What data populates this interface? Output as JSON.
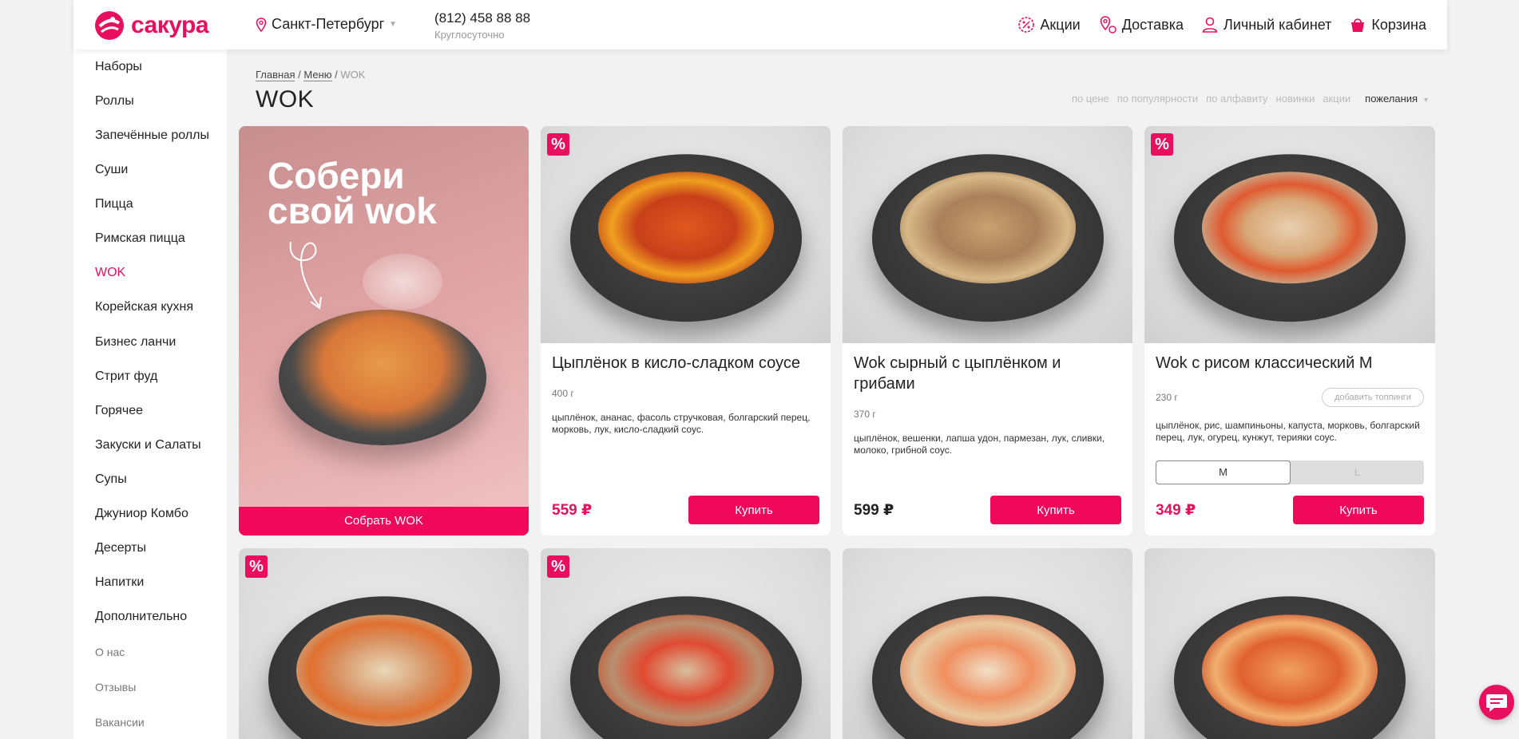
{
  "header": {
    "logo_text": "сакура",
    "city": "Санкт-Петербург",
    "phone": "(812) 458 88 88",
    "phone_note": "Круглосуточно",
    "nav": [
      {
        "label": "Акции",
        "icon": "percent-badge-icon"
      },
      {
        "label": "Доставка",
        "icon": "map-pin-icon"
      },
      {
        "label": "Личный кабинет",
        "icon": "user-icon"
      },
      {
        "label": "Корзина",
        "icon": "basket-icon"
      }
    ]
  },
  "sidebar": {
    "items": [
      {
        "label": "Наборы"
      },
      {
        "label": "Роллы"
      },
      {
        "label": "Запечённые роллы"
      },
      {
        "label": "Суши"
      },
      {
        "label": "Пицца"
      },
      {
        "label": "Римская пицца"
      },
      {
        "label": "WOK",
        "active": true
      },
      {
        "label": "Корейская кухня"
      },
      {
        "label": "Бизнес ланчи"
      },
      {
        "label": "Стрит фуд"
      },
      {
        "label": "Горячее"
      },
      {
        "label": "Закуски и Салаты"
      },
      {
        "label": "Супы"
      },
      {
        "label": "Джуниор Комбо"
      },
      {
        "label": "Десерты"
      },
      {
        "label": "Напитки"
      },
      {
        "label": "Дополнительно"
      }
    ],
    "secondary": [
      {
        "label": "О нас"
      },
      {
        "label": "Отзывы"
      },
      {
        "label": "Вакансии"
      }
    ]
  },
  "breadcrumb": {
    "home": "Главная",
    "menu": "Меню",
    "current": "WOK",
    "sep": "/"
  },
  "page_title": "WOK",
  "sort": {
    "options": [
      "по цене",
      "по популярности",
      "по алфавиту",
      "новинки",
      "акции"
    ],
    "selected": "пожелания"
  },
  "promo": {
    "line1": "Собери",
    "line2": "свой wok",
    "button": "Собрать WOK"
  },
  "products": [
    {
      "title": "Цыплёнок в кисло-сладком соусе",
      "weight": "400 г",
      "desc": "цыплёнок, ананас, фасоль стручковая, болгарский перец, морковь, лук, кисло-сладкий соус.",
      "price": "559 ₽",
      "buy": "Купить",
      "discount_badge": "%"
    },
    {
      "title": "Wok сырный с цыплёнком и грибами",
      "weight": "370 г",
      "desc": "цыплёнок, вешенки, лапша удон, пармезан, лук, сливки, молоко, грибной соус.",
      "price": "599 ₽",
      "buy": "Купить"
    },
    {
      "title": "Wok с рисом классический M",
      "weight": "230 г",
      "topping": "добавить топпинги",
      "desc": "цыплёнок, рис, шампиньоны, капуста, морковь, болгарский перец, лук, огурец, кунжут, терияки соус.",
      "sizes": [
        "M",
        "L"
      ],
      "size_selected": "M",
      "price": "349 ₽",
      "buy": "Купить",
      "discount_badge": "%"
    }
  ],
  "second_row_badges": [
    "%",
    "%"
  ],
  "colors": {
    "brand": "#e8105e",
    "button": "#f0095b",
    "page_bg": "#f2f2f2"
  }
}
